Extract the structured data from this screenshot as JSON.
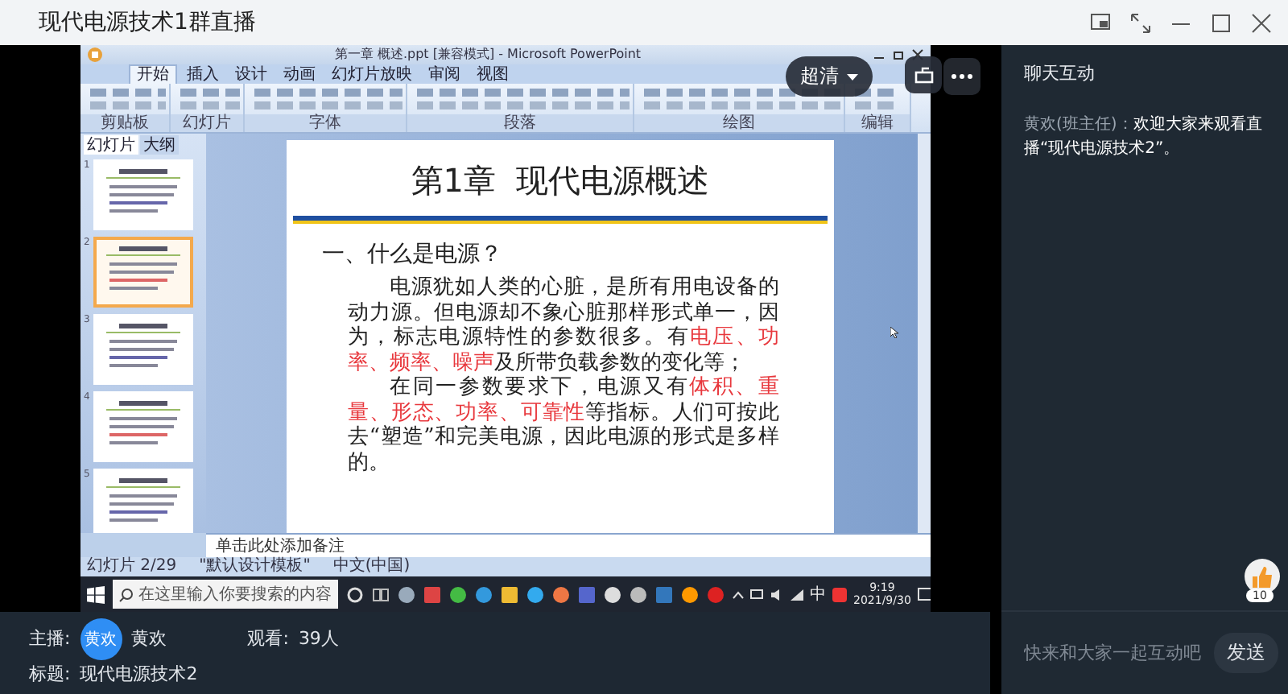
{
  "window": {
    "title": "现代电源技术1群直播"
  },
  "video": {
    "quality_button": "超清"
  },
  "screen": {
    "app_title": "第一章 概述.ppt [兼容模式] - Microsoft PowerPoint",
    "ribbon_tabs": [
      {
        "label": "开始",
        "selected": true
      },
      {
        "label": "插入",
        "selected": false
      },
      {
        "label": "设计",
        "selected": false
      },
      {
        "label": "动画",
        "selected": false
      },
      {
        "label": "幻灯片放映",
        "selected": false
      },
      {
        "label": "审阅",
        "selected": false
      },
      {
        "label": "视图",
        "selected": false
      }
    ],
    "ribbon_groups": [
      "剪贴板",
      "幻灯片",
      "字体",
      "段落",
      "绘图",
      "编辑"
    ],
    "pane_tabs": [
      {
        "label": "幻灯片",
        "selected": true
      },
      {
        "label": "大纲",
        "selected": false
      }
    ],
    "thumbnails": [
      {
        "number": "1",
        "selected": false
      },
      {
        "number": "2",
        "selected": true
      },
      {
        "number": "3",
        "selected": false
      },
      {
        "number": "4",
        "selected": false
      },
      {
        "number": "5",
        "selected": false
      }
    ],
    "slide": {
      "title": "第1章  现代电源概述",
      "heading": "一、什么是电源？",
      "paragraphs": [
        [
          {
            "text": "电源犹如人类的心脏，是所有用电设备的动力源。但电源却不象心脏那样形式单一，因为，标志电源特性的参数很多。有",
            "highlight": false
          },
          {
            "text": "电压、功率、频率、噪声",
            "highlight": true
          },
          {
            "text": "及所带负载参数的变化等；",
            "highlight": false
          }
        ],
        [
          {
            "text": "在同一参数要求下，电源又有",
            "highlight": false
          },
          {
            "text": "体积、重量、形态、功率、可靠性",
            "highlight": true
          },
          {
            "text": "等指标。人们可按此去“塑造”和完美电源，因此电源的形式是多样的。",
            "highlight": false
          }
        ]
      ]
    },
    "notes_placeholder": "单击此处添加备注",
    "status": [
      "幻灯片 2/29",
      "\"默认设计模板\"",
      "中文(中国)"
    ],
    "taskbar": {
      "search_placeholder": "在这里输入你要搜索的内容",
      "ime": "中",
      "time": "9:19",
      "date": "2021/9/30"
    }
  },
  "host": {
    "label": "主播:",
    "avatar": "黄欢",
    "name": "黄欢"
  },
  "viewers": {
    "label": "观看:",
    "count": "39人"
  },
  "stream_title": {
    "label": "标题:",
    "value": "现代电源技术2"
  },
  "chat": {
    "title": "聊天互动",
    "messages": [
      {
        "sender": "黄欢(班主任)：",
        "text": "欢迎大家来观看直播“现代电源技术2”。"
      }
    ],
    "likes": "10",
    "input": {
      "placeholder": "快来和大家一起互动吧"
    },
    "send_button": "发送"
  }
}
